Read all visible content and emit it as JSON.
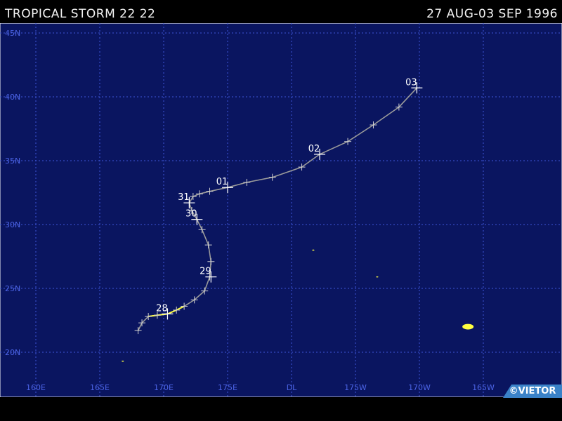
{
  "header": {
    "title": "TROPICAL STORM 22 22",
    "dates": "27 AUG-03 SEP 1996"
  },
  "map": {
    "background": "#0a1560",
    "grid_color": "#3d55d8",
    "lat_labels": [
      "45N",
      "40N",
      "35N",
      "30N",
      "25N",
      "20N"
    ],
    "lon_labels": [
      "160E",
      "165E",
      "170E",
      "175E",
      "DL",
      "175W",
      "170W",
      "165W"
    ],
    "track_color": "#9a9a9a",
    "marker_color": "#d0d0d0",
    "early_track_color": "#ffff40",
    "day_labels": [
      {
        "text": "28",
        "lon": 170.3,
        "lat": 23.0
      },
      {
        "text": "29",
        "lon": 173.7,
        "lat": 25.9
      },
      {
        "text": "30",
        "lon": 172.6,
        "lat": 30.4
      },
      {
        "text": "31",
        "lon": 172.0,
        "lat": 31.7
      },
      {
        "text": "01",
        "lon": 175.0,
        "lat": 32.9
      },
      {
        "text": "02",
        "lon": 182.2,
        "lat": 35.5
      },
      {
        "text": "03",
        "lon": 189.8,
        "lat": 40.7
      }
    ],
    "track": [
      [
        168.0,
        21.7
      ],
      [
        168.3,
        22.3
      ],
      [
        168.8,
        22.8
      ],
      [
        169.5,
        22.9
      ],
      [
        170.3,
        23.0
      ],
      [
        171.0,
        23.3
      ],
      [
        171.6,
        23.6
      ],
      [
        172.4,
        24.1
      ],
      [
        173.2,
        24.8
      ],
      [
        173.6,
        25.9
      ],
      [
        173.7,
        27.1
      ],
      [
        173.5,
        28.4
      ],
      [
        173.0,
        29.6
      ],
      [
        172.6,
        30.4
      ],
      [
        172.2,
        31.1
      ],
      [
        172.0,
        31.7
      ],
      [
        172.3,
        32.2
      ],
      [
        172.8,
        32.4
      ],
      [
        173.6,
        32.6
      ],
      [
        175.0,
        32.9
      ],
      [
        176.5,
        33.3
      ],
      [
        178.5,
        33.7
      ],
      [
        180.8,
        34.5
      ],
      [
        182.2,
        35.5
      ],
      [
        184.4,
        36.5
      ],
      [
        186.4,
        37.8
      ],
      [
        188.4,
        39.2
      ],
      [
        189.8,
        40.7
      ]
    ],
    "yellow_track": [
      [
        168.8,
        22.8
      ],
      [
        169.5,
        22.9
      ],
      [
        170.3,
        23.0
      ],
      [
        171.0,
        23.3
      ],
      [
        171.6,
        23.6
      ]
    ],
    "islands": [
      {
        "lon": 181.7,
        "lat": 28.0,
        "size": 1
      },
      {
        "lon": 186.7,
        "lat": 25.9,
        "size": 1
      },
      {
        "lon": 166.8,
        "lat": 19.3,
        "size": 1
      },
      {
        "lon": 193.8,
        "lat": 22.0,
        "size": 5
      }
    ],
    "credit": "©VIETOR"
  }
}
